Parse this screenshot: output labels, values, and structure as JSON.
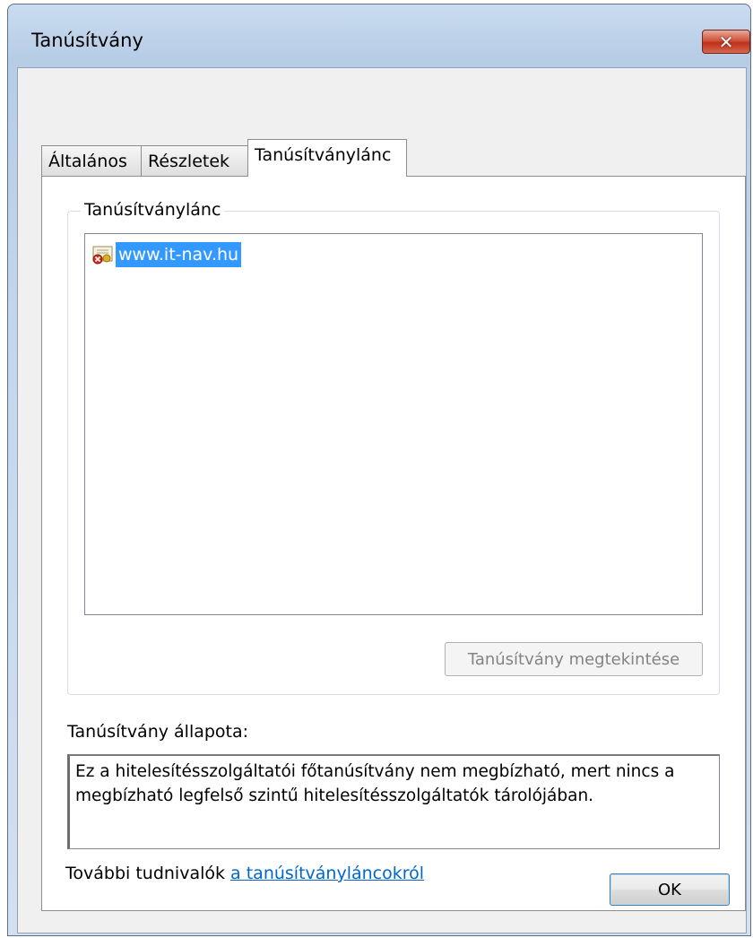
{
  "window": {
    "title": "Tanúsítvány",
    "close_label": "✕"
  },
  "tabs": [
    {
      "label": "Általános",
      "active": false
    },
    {
      "label": "Részletek",
      "active": false
    },
    {
      "label": "Tanúsítványlánc",
      "active": true
    }
  ],
  "chain_group": {
    "legend": "Tanúsítványlánc",
    "items": [
      {
        "label": "www.it-nav.hu",
        "icon": "certificate-error-icon",
        "selected": true
      }
    ],
    "view_button": "Tanúsítvány megtekintése"
  },
  "status": {
    "label": "Tanúsítvány állapota:",
    "line1": "Ez a hitelesítésszolgáltatói főtanúsítvány nem megbízható, mert nincs a",
    "line2": "megbízható legfelső szintű hitelesítésszolgáltatók tárolójában."
  },
  "more_info": {
    "prefix": "További tudnivalók ",
    "link": "a tanúsítványláncokról"
  },
  "footer": {
    "ok_label": "OK"
  },
  "colors": {
    "selection": "#3399ff",
    "link": "#0066cc",
    "close_button": "#c0301c"
  }
}
